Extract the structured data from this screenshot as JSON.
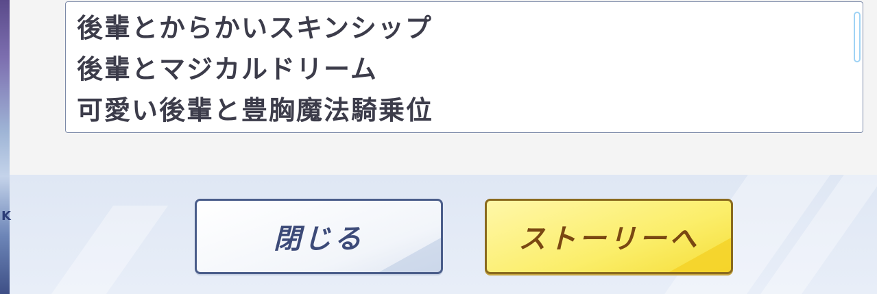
{
  "list": {
    "items": [
      "後輩とからかいスキンシップ",
      "後輩とマジカルドリーム",
      "可愛い後輩と豊胸魔法騎乗位"
    ]
  },
  "buttons": {
    "close_label": "閉じる",
    "story_label": "ストーリーへ"
  },
  "left_art": {
    "mark": "K"
  },
  "colors": {
    "close_border": "#4a5d8a",
    "story_fill": "#fbee6a",
    "story_text": "#7a4812",
    "list_text": "#3c3c4a"
  }
}
